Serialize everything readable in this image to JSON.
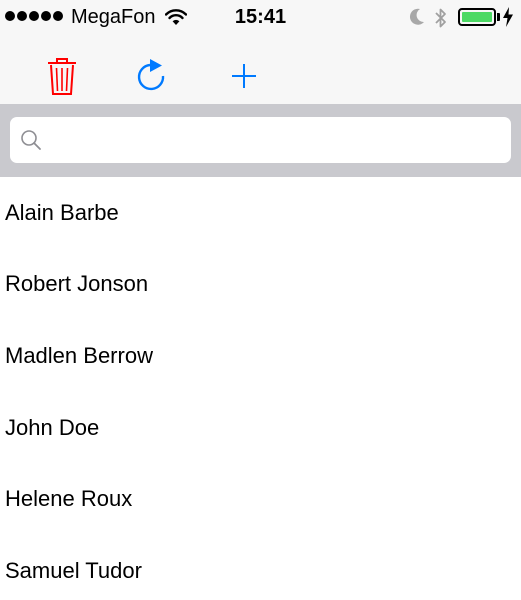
{
  "status_bar": {
    "carrier": "MegaFon",
    "time": "15:41",
    "signal_bars": 5,
    "battery_level": 1.0,
    "battery_color": "#4cd964",
    "icons": [
      "signal-dots-icon",
      "wifi-icon",
      "moon-icon",
      "bluetooth-icon",
      "battery-icon",
      "charging-bolt-icon"
    ]
  },
  "toolbar": {
    "delete_icon": "trash-icon",
    "delete_color": "#ff0000",
    "refresh_icon": "refresh-icon",
    "add_icon": "plus-icon",
    "accent_color": "#007aff"
  },
  "search": {
    "placeholder": "",
    "value": ""
  },
  "contacts": [
    {
      "name": "Alain Barbe"
    },
    {
      "name": "Robert Jonson"
    },
    {
      "name": "Madlen Berrow"
    },
    {
      "name": "John Doe"
    },
    {
      "name": "Helene Roux"
    },
    {
      "name": "Samuel Tudor"
    }
  ]
}
